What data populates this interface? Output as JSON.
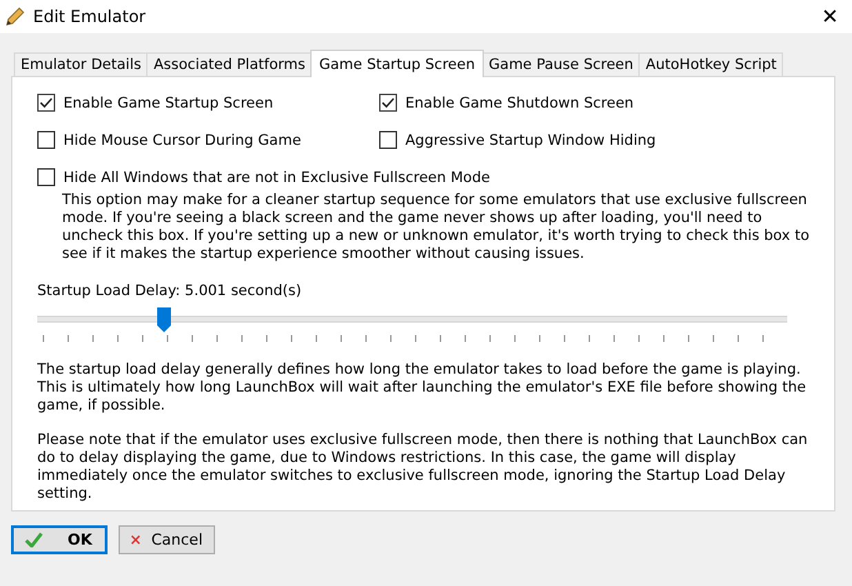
{
  "window": {
    "title": "Edit Emulator",
    "close": "✕"
  },
  "tabs": [
    {
      "label": "Emulator Details",
      "selected": false
    },
    {
      "label": "Associated Platforms",
      "selected": false
    },
    {
      "label": "Game Startup Screen",
      "selected": true
    },
    {
      "label": "Game Pause Screen",
      "selected": false
    },
    {
      "label": "AutoHotkey Script",
      "selected": false
    }
  ],
  "options": [
    {
      "label": "Enable Game Startup Screen",
      "checked": true
    },
    {
      "label": "Enable Game Shutdown Screen",
      "checked": true
    },
    {
      "label": "Hide Mouse Cursor During Game",
      "checked": false
    },
    {
      "label": "Aggressive Startup Window Hiding",
      "checked": false
    }
  ],
  "hide_windows": {
    "label": "Hide All Windows that are not in Exclusive Fullscreen Mode",
    "checked": false,
    "description": "This option may make for a cleaner startup sequence for some emulators that use exclusive fullscreen mode. If you're seeing a black screen and the game never shows up after loading, you'll need to uncheck this box. If you're setting up a new or unknown emulator, it's worth trying to check this box to see if it makes the startup experience smoother without causing issues."
  },
  "delay": {
    "label": "Startup Load Delay: 5.001 second(s)",
    "level": 0.17
  },
  "notes": [
    "The startup load delay generally defines how long the emulator takes to load before the game is playing. This is ultimately how long LaunchBox will wait after launching the emulator's EXE file before showing the game, if possible.",
    "Please note that if the emulator uses exclusive fullscreen mode, then there is nothing that LaunchBox can do to delay displaying the game, due to Windows restrictions. In this case, the game will display immediately once the emulator switches to exclusive fullscreen mode, ignoring the Startup Load Delay setting."
  ],
  "buttons": [
    {
      "label": "OK",
      "kind": "ok"
    },
    {
      "label": "Cancel",
      "kind": "cancel"
    }
  ]
}
